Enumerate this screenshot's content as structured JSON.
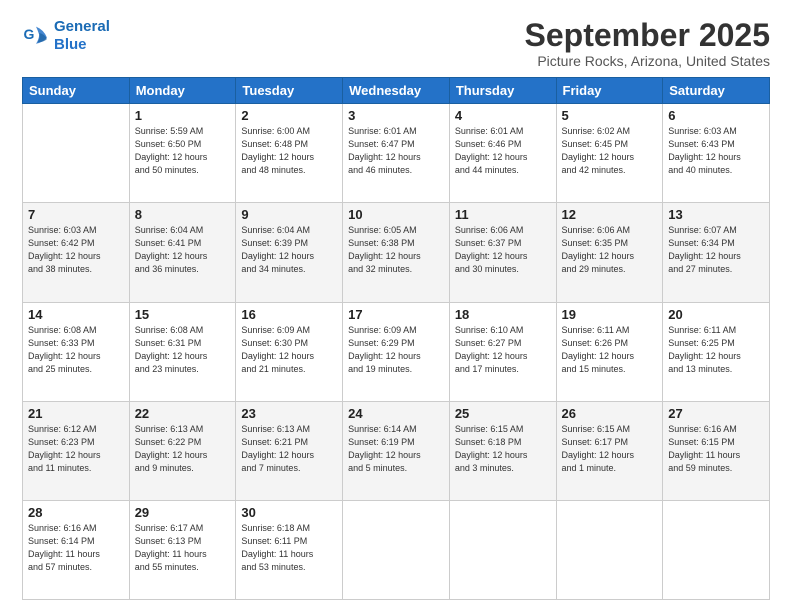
{
  "header": {
    "logo_line1": "General",
    "logo_line2": "Blue",
    "title": "September 2025",
    "subtitle": "Picture Rocks, Arizona, United States"
  },
  "weekdays": [
    "Sunday",
    "Monday",
    "Tuesday",
    "Wednesday",
    "Thursday",
    "Friday",
    "Saturday"
  ],
  "weeks": [
    [
      {
        "day": "",
        "info": ""
      },
      {
        "day": "1",
        "info": "Sunrise: 5:59 AM\nSunset: 6:50 PM\nDaylight: 12 hours\nand 50 minutes."
      },
      {
        "day": "2",
        "info": "Sunrise: 6:00 AM\nSunset: 6:48 PM\nDaylight: 12 hours\nand 48 minutes."
      },
      {
        "day": "3",
        "info": "Sunrise: 6:01 AM\nSunset: 6:47 PM\nDaylight: 12 hours\nand 46 minutes."
      },
      {
        "day": "4",
        "info": "Sunrise: 6:01 AM\nSunset: 6:46 PM\nDaylight: 12 hours\nand 44 minutes."
      },
      {
        "day": "5",
        "info": "Sunrise: 6:02 AM\nSunset: 6:45 PM\nDaylight: 12 hours\nand 42 minutes."
      },
      {
        "day": "6",
        "info": "Sunrise: 6:03 AM\nSunset: 6:43 PM\nDaylight: 12 hours\nand 40 minutes."
      }
    ],
    [
      {
        "day": "7",
        "info": "Sunrise: 6:03 AM\nSunset: 6:42 PM\nDaylight: 12 hours\nand 38 minutes."
      },
      {
        "day": "8",
        "info": "Sunrise: 6:04 AM\nSunset: 6:41 PM\nDaylight: 12 hours\nand 36 minutes."
      },
      {
        "day": "9",
        "info": "Sunrise: 6:04 AM\nSunset: 6:39 PM\nDaylight: 12 hours\nand 34 minutes."
      },
      {
        "day": "10",
        "info": "Sunrise: 6:05 AM\nSunset: 6:38 PM\nDaylight: 12 hours\nand 32 minutes."
      },
      {
        "day": "11",
        "info": "Sunrise: 6:06 AM\nSunset: 6:37 PM\nDaylight: 12 hours\nand 30 minutes."
      },
      {
        "day": "12",
        "info": "Sunrise: 6:06 AM\nSunset: 6:35 PM\nDaylight: 12 hours\nand 29 minutes."
      },
      {
        "day": "13",
        "info": "Sunrise: 6:07 AM\nSunset: 6:34 PM\nDaylight: 12 hours\nand 27 minutes."
      }
    ],
    [
      {
        "day": "14",
        "info": "Sunrise: 6:08 AM\nSunset: 6:33 PM\nDaylight: 12 hours\nand 25 minutes."
      },
      {
        "day": "15",
        "info": "Sunrise: 6:08 AM\nSunset: 6:31 PM\nDaylight: 12 hours\nand 23 minutes."
      },
      {
        "day": "16",
        "info": "Sunrise: 6:09 AM\nSunset: 6:30 PM\nDaylight: 12 hours\nand 21 minutes."
      },
      {
        "day": "17",
        "info": "Sunrise: 6:09 AM\nSunset: 6:29 PM\nDaylight: 12 hours\nand 19 minutes."
      },
      {
        "day": "18",
        "info": "Sunrise: 6:10 AM\nSunset: 6:27 PM\nDaylight: 12 hours\nand 17 minutes."
      },
      {
        "day": "19",
        "info": "Sunrise: 6:11 AM\nSunset: 6:26 PM\nDaylight: 12 hours\nand 15 minutes."
      },
      {
        "day": "20",
        "info": "Sunrise: 6:11 AM\nSunset: 6:25 PM\nDaylight: 12 hours\nand 13 minutes."
      }
    ],
    [
      {
        "day": "21",
        "info": "Sunrise: 6:12 AM\nSunset: 6:23 PM\nDaylight: 12 hours\nand 11 minutes."
      },
      {
        "day": "22",
        "info": "Sunrise: 6:13 AM\nSunset: 6:22 PM\nDaylight: 12 hours\nand 9 minutes."
      },
      {
        "day": "23",
        "info": "Sunrise: 6:13 AM\nSunset: 6:21 PM\nDaylight: 12 hours\nand 7 minutes."
      },
      {
        "day": "24",
        "info": "Sunrise: 6:14 AM\nSunset: 6:19 PM\nDaylight: 12 hours\nand 5 minutes."
      },
      {
        "day": "25",
        "info": "Sunrise: 6:15 AM\nSunset: 6:18 PM\nDaylight: 12 hours\nand 3 minutes."
      },
      {
        "day": "26",
        "info": "Sunrise: 6:15 AM\nSunset: 6:17 PM\nDaylight: 12 hours\nand 1 minute."
      },
      {
        "day": "27",
        "info": "Sunrise: 6:16 AM\nSunset: 6:15 PM\nDaylight: 11 hours\nand 59 minutes."
      }
    ],
    [
      {
        "day": "28",
        "info": "Sunrise: 6:16 AM\nSunset: 6:14 PM\nDaylight: 11 hours\nand 57 minutes."
      },
      {
        "day": "29",
        "info": "Sunrise: 6:17 AM\nSunset: 6:13 PM\nDaylight: 11 hours\nand 55 minutes."
      },
      {
        "day": "30",
        "info": "Sunrise: 6:18 AM\nSunset: 6:11 PM\nDaylight: 11 hours\nand 53 minutes."
      },
      {
        "day": "",
        "info": ""
      },
      {
        "day": "",
        "info": ""
      },
      {
        "day": "",
        "info": ""
      },
      {
        "day": "",
        "info": ""
      }
    ]
  ]
}
